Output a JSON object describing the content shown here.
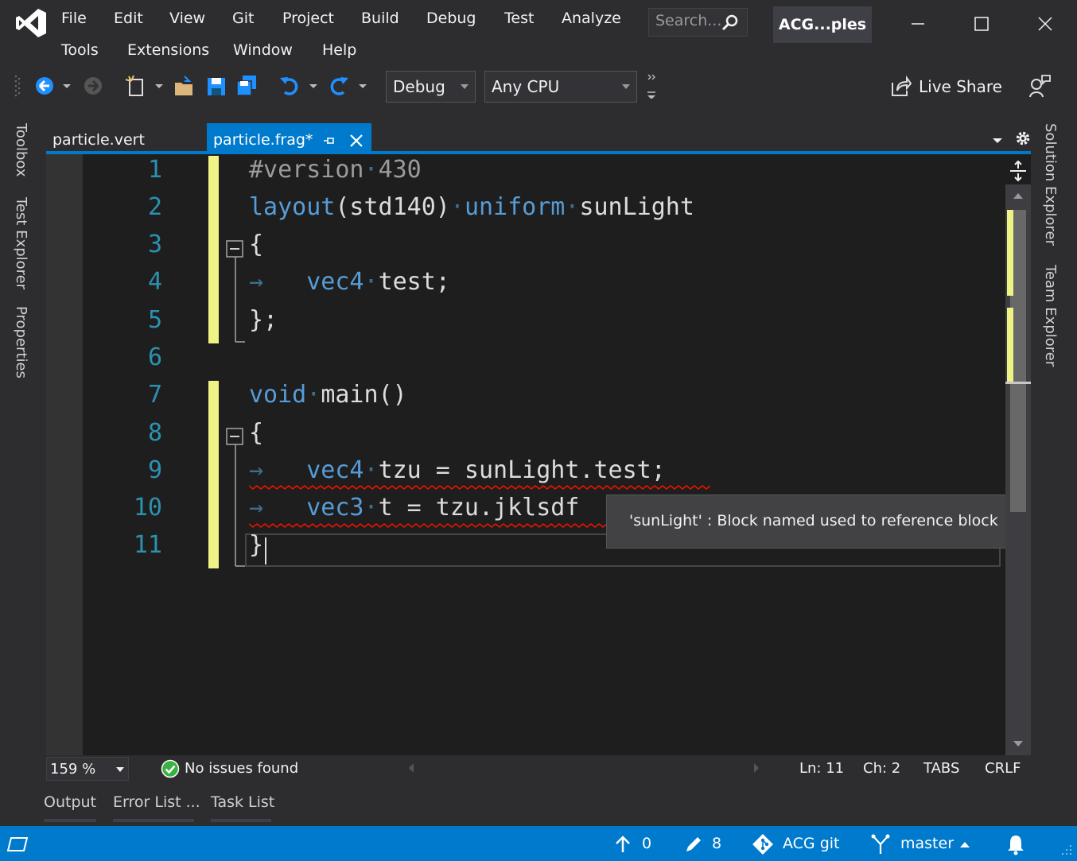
{
  "menu": {
    "row1": [
      "File",
      "Edit",
      "View",
      "Git",
      "Project",
      "Build",
      "Debug",
      "Test",
      "Analyze"
    ],
    "row2": [
      "Tools",
      "Extensions",
      "Window",
      "Help"
    ]
  },
  "search": {
    "placeholder": "Search..."
  },
  "window": {
    "title": "ACG...ples"
  },
  "toolbar": {
    "config": "Debug",
    "platform": "Any CPU",
    "live_share": "Live Share"
  },
  "side_tabs_left": [
    "Toolbox",
    "Test Explorer",
    "Properties"
  ],
  "side_tabs_right": [
    "Solution Explorer",
    "Team Explorer"
  ],
  "tabs": [
    {
      "label": "particle.vert",
      "active": false
    },
    {
      "label": "particle.frag*",
      "active": true
    }
  ],
  "code_lines": [
    "1",
    "2",
    "3",
    "4",
    "5",
    "6",
    "7",
    "8",
    "9",
    "10",
    "11"
  ],
  "code": {
    "l1": {
      "pp": "#version",
      "rest": "430"
    },
    "l2": {
      "kw1": "layout",
      "p1": "(std140)",
      "kw2": "uniform",
      "name": "sunLight"
    },
    "l3": "{",
    "l4": {
      "kw": "vec4",
      "rest": "test;"
    },
    "l5": "};",
    "l7": {
      "kw": "void",
      "rest": "main()"
    },
    "l8": "{",
    "l9": {
      "kw": "vec4",
      "rest": "tzu = sunLight.test;"
    },
    "l10": {
      "kw": "vec3",
      "rest": "t = tzu.jklsdf"
    },
    "l11": "}"
  },
  "tooltip": "'sunLight' : Block named used to reference block",
  "editor_status": {
    "zoom": "159 %",
    "issues": "No issues found",
    "line": "Ln: 11",
    "col": "Ch: 2",
    "indent": "TABS",
    "eol": "CRLF"
  },
  "bottom_tabs": [
    "Output",
    "Error List ...",
    "Task List"
  ],
  "statusbar": {
    "push_count": "0",
    "edit_count": "8",
    "repo": "ACG git",
    "branch": "master"
  },
  "colors": {
    "accent": "#007acc",
    "keyword": "#569cd6",
    "line_number": "#2b91af",
    "change_marker": "#eff284",
    "error_squiggle": "#e51400"
  }
}
